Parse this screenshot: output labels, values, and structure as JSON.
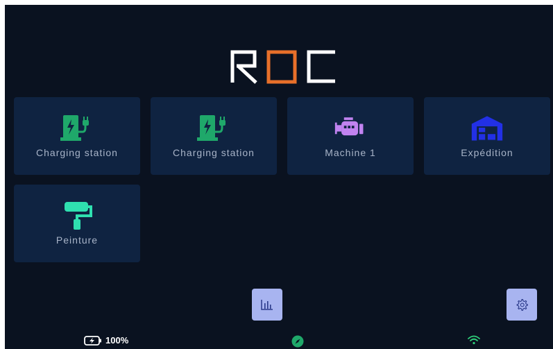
{
  "app": {
    "logo_text": "ROC",
    "logo_accent": "#e8702a"
  },
  "tiles": [
    {
      "label": "Charging station",
      "icon": "ev-charger-icon",
      "color": "#1fa86a"
    },
    {
      "label": "Charging station",
      "icon": "ev-charger-icon",
      "color": "#1fa86a"
    },
    {
      "label": "Machine 1",
      "icon": "engine-icon",
      "color": "#c183f0"
    },
    {
      "label": "Expédition",
      "icon": "warehouse-icon",
      "color": "#2230e6"
    },
    {
      "label": "Peinture",
      "icon": "paint-roller-icon",
      "color": "#2fe0b0"
    }
  ],
  "controls": {
    "stats_icon": "bar-chart-icon",
    "settings_icon": "gear-icon"
  },
  "status_bar": {
    "battery_icon": "battery-charging-icon",
    "battery_level": "100%",
    "compass_icon": "compass-icon",
    "wifi_icon": "wifi-icon"
  }
}
